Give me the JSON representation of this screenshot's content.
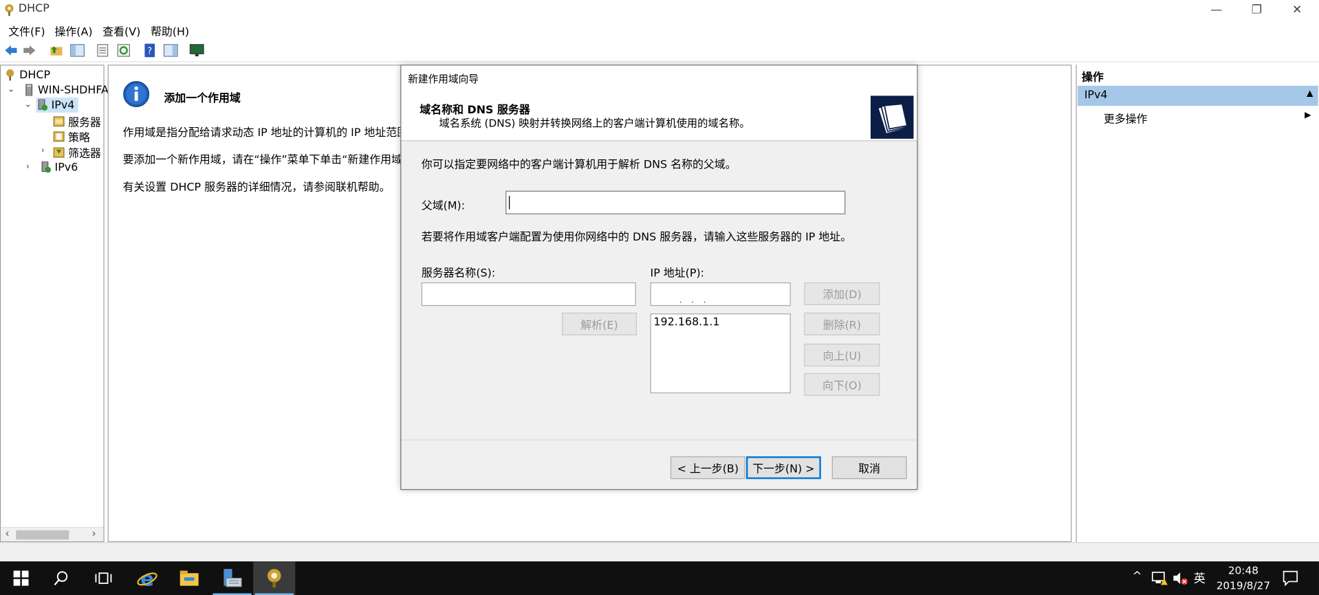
{
  "window": {
    "title": "DHCP",
    "minimize_glyph": "—",
    "restore_glyph": "❐",
    "close_glyph": "✕"
  },
  "menu": [
    "文件(F)",
    "操作(A)",
    "查看(V)",
    "帮助(H)"
  ],
  "toolbar": [
    "back-icon",
    "forward-icon",
    "up-folder-icon",
    "show-hide-tree-icon",
    "properties-icon",
    "refresh-icon",
    "help-icon",
    "show-hide-action-pane-icon",
    "monitor-icon"
  ],
  "tree": {
    "root": "DHCP",
    "server": "WIN-SHDHFA",
    "ipv4": "IPv4",
    "children": [
      "服务器",
      "策略",
      "筛选器"
    ],
    "ipv6": "IPv6",
    "scroll_left": "‹",
    "scroll_right": "›"
  },
  "middle": {
    "title": "添加一个作用域",
    "line1": "作用域是指分配给请求动态 IP 地址的计算机的 IP 地址范围。",
    "line2": "要添加一个新作用域，请在“操作”菜单下单击“新建作用域”。",
    "line3": "有关设置 DHCP 服务器的详细情况，请参阅联机帮助。"
  },
  "actions": {
    "header": "操作",
    "selected": "IPv4",
    "more": "更多操作",
    "collapse_glyph": "▲",
    "more_arrow": "▶"
  },
  "dialog": {
    "title": "新建作用域向导",
    "heading": "域名称和 DNS 服务器",
    "subheading": "域名系统 (DNS) 映射并转换网络上的客户端计算机使用的域名称。",
    "intro": "你可以指定要网络中的客户端计算机用于解析 DNS 名称的父域。",
    "parent_domain_label": "父域(M):",
    "parent_domain_value": "",
    "dns_note": "若要将作用域客户端配置为使用你网络中的 DNS 服务器，请输入这些服务器的 IP 地址。",
    "server_name_label": "服务器名称(S):",
    "server_name_value": "",
    "ip_label": "IP 地址(P):",
    "ip_placeholder": "   .    .    .",
    "resolve_button": "解析(E)",
    "add_button": "添加(D)",
    "remove_button": "删除(R)",
    "up_button": "向上(U)",
    "down_button": "向下(O)",
    "ip_list": [
      "192.168.1.1"
    ],
    "back_button": "< 上一步(B)",
    "next_button": "下一步(N) >",
    "cancel_button": "取消"
  },
  "taskbar": {
    "apps": [
      "start-icon",
      "search-icon",
      "task-view-icon",
      "ie-icon",
      "file-explorer-icon",
      "server-manager-icon",
      "dhcp-icon"
    ],
    "tray_chevron": "^",
    "ime": "英",
    "time": "20:48",
    "date": "2019/8/27"
  },
  "colors": {
    "selection": "#a6c8e8",
    "default_button_border": "#0078d7",
    "taskbar": "#101010",
    "dialog_bg": "#f0f0f0"
  }
}
